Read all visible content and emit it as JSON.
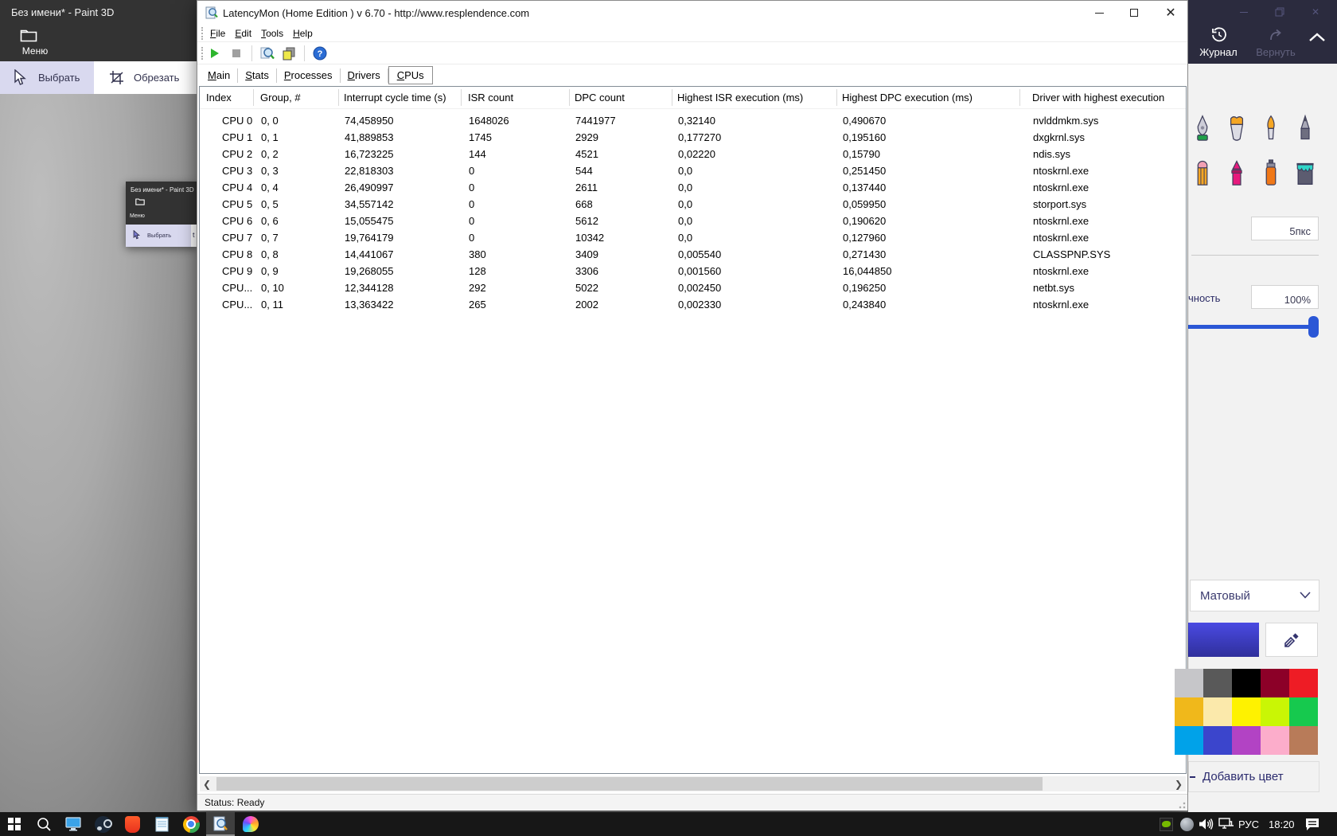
{
  "latencymon": {
    "title": "LatencyMon (Home Edition ) v 6.70 - http://www.resplendence.com",
    "menu": [
      "File",
      "Edit",
      "Tools",
      "Help"
    ],
    "toolbar_icons": [
      "play",
      "stop",
      "analyze-driver",
      "copy-report",
      "help"
    ],
    "tabs": [
      "Main",
      "Stats",
      "Processes",
      "Drivers",
      "CPUs"
    ],
    "active_tab": "CPUs",
    "table": {
      "columns": [
        "Index",
        "Group, #",
        "Interrupt cycle time (s)",
        "ISR count",
        "DPC count",
        "Highest ISR execution (ms)",
        "Highest DPC execution (ms)",
        "Driver with highest execution"
      ],
      "rows": [
        [
          "CPU 0",
          "0, 0",
          "74,458950",
          "1648026",
          "7441977",
          "0,32140",
          "0,490670",
          "nvlddmkm.sys"
        ],
        [
          "CPU 1",
          "0, 1",
          "41,889853",
          "1745",
          "2929",
          "0,177270",
          "0,195160",
          "dxgkrnl.sys"
        ],
        [
          "CPU 2",
          "0, 2",
          "16,723225",
          "144",
          "4521",
          "0,02220",
          "0,15790",
          "ndis.sys"
        ],
        [
          "CPU 3",
          "0, 3",
          "22,818303",
          "0",
          "544",
          "0,0",
          "0,251450",
          "ntoskrnl.exe"
        ],
        [
          "CPU 4",
          "0, 4",
          "26,490997",
          "0",
          "2611",
          "0,0",
          "0,137440",
          "ntoskrnl.exe"
        ],
        [
          "CPU 5",
          "0, 5",
          "34,557142",
          "0",
          "668",
          "0,0",
          "0,059950",
          "storport.sys"
        ],
        [
          "CPU 6",
          "0, 6",
          "15,055475",
          "0",
          "5612",
          "0,0",
          "0,190620",
          "ntoskrnl.exe"
        ],
        [
          "CPU 7",
          "0, 7",
          "19,764179",
          "0",
          "10342",
          "0,0",
          "0,127960",
          "ntoskrnl.exe"
        ],
        [
          "CPU 8",
          "0, 8",
          "14,441067",
          "380",
          "3409",
          "0,005540",
          "0,271430",
          "CLASSPNP.SYS"
        ],
        [
          "CPU 9",
          "0, 9",
          "19,268055",
          "128",
          "3306",
          "0,001560",
          "16,044850",
          "ntoskrnl.exe"
        ],
        [
          "CPU...",
          "0, 10",
          "12,344128",
          "292",
          "5022",
          "0,002450",
          "0,196250",
          "netbt.sys"
        ],
        [
          "CPU...",
          "0, 11",
          "13,363422",
          "265",
          "2002",
          "0,002330",
          "0,243840",
          "ntoskrnl.exe"
        ]
      ]
    },
    "status": "Status: Ready"
  },
  "paint3d": {
    "left": {
      "title": "Без имени* - Paint 3D",
      "menu_label": "Меню",
      "select_label": "Выбрать",
      "crop_label": "Обрезать"
    },
    "mini": {
      "title": "Без имени* - Paint 3D",
      "menu_label": "Меню",
      "select_label": "Выбрать"
    },
    "right": {
      "history_label": "Журнал",
      "redo_label": "Вернуть",
      "tools": [
        "marker-pen",
        "brush",
        "oil-brush",
        "pencil",
        "eraser",
        "crayon",
        "spray-can",
        "fill-bucket"
      ],
      "thickness_value": "5пкс",
      "opacity_label_visible": "чность",
      "opacity_value": "100%",
      "material_selected": "Матовый",
      "current_color": "#3b3bc8",
      "add_color_label": "Добавить цвет",
      "palette": [
        [
          "#c6c6c9",
          "#595959",
          "#000000",
          "#8c0028",
          "#ee1c25"
        ],
        [
          "#f0b81b",
          "#fbe9ab",
          "#fef200",
          "#c9f605",
          "#16c94e"
        ],
        [
          "#00a2e9",
          "#3b45cc",
          "#b243c4",
          "#fcadcb",
          "#b87b59"
        ]
      ]
    }
  },
  "taskbar": {
    "apps": [
      "start",
      "search",
      "this-pc",
      "steam",
      "brave",
      "notepad",
      "chrome",
      "latencymon",
      "paint3d"
    ],
    "active_app": "latencymon",
    "tray": {
      "language": "РУС",
      "time": "18:20"
    }
  }
}
